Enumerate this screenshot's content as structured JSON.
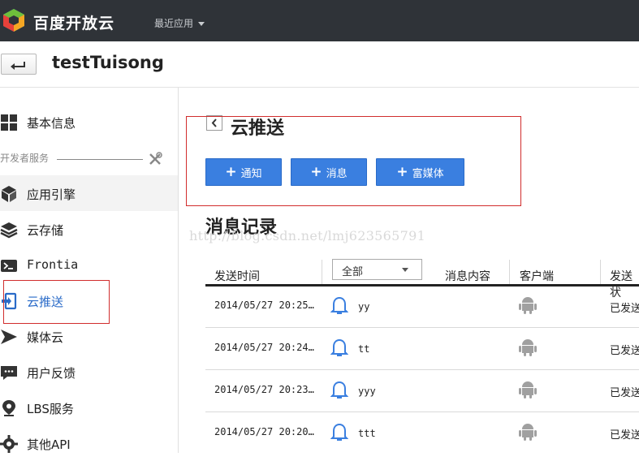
{
  "topbar": {
    "brand": "百度开放云",
    "recent_apps": "最近应用"
  },
  "app": {
    "title": "testTuisong"
  },
  "sidebar": {
    "items": [
      {
        "label": "基本信息",
        "icon": "grid-icon"
      },
      {
        "label": "应用引擎",
        "icon": "cube-icon"
      },
      {
        "label": "云存储",
        "icon": "layers-icon"
      },
      {
        "label": "Frontia",
        "icon": "terminal-icon"
      },
      {
        "label": "云推送",
        "icon": "push-icon"
      },
      {
        "label": "媒体云",
        "icon": "play-icon"
      },
      {
        "label": "用户反馈",
        "icon": "chat-icon"
      },
      {
        "label": "LBS服务",
        "icon": "location-pin-icon"
      },
      {
        "label": "其他API",
        "icon": "gear-icon"
      }
    ],
    "section_label": "开发者服务"
  },
  "main": {
    "title": "云推送",
    "buttons": [
      "通知",
      "消息",
      "富媒体"
    ],
    "records_title": "消息记录",
    "watermark": "http://blog.csdn.net/lmj623565791"
  },
  "table": {
    "headers": [
      "发送时间",
      "消息内容",
      "客户端",
      "发送状"
    ],
    "filter_value": "全部",
    "rows": [
      {
        "time": "2014/05/27 20:25…",
        "content": "yy",
        "status": "已发送"
      },
      {
        "time": "2014/05/27 20:24…",
        "content": "tt",
        "status": "已发送"
      },
      {
        "time": "2014/05/27 20:23…",
        "content": "yyy",
        "status": "已发送"
      },
      {
        "time": "2014/05/27 20:20…",
        "content": "ttt",
        "status": "已发送"
      }
    ]
  },
  "colors": {
    "topbar": "#2f3338",
    "button_blue": "#3a7fe0",
    "highlight_red": "#d12d2d"
  }
}
